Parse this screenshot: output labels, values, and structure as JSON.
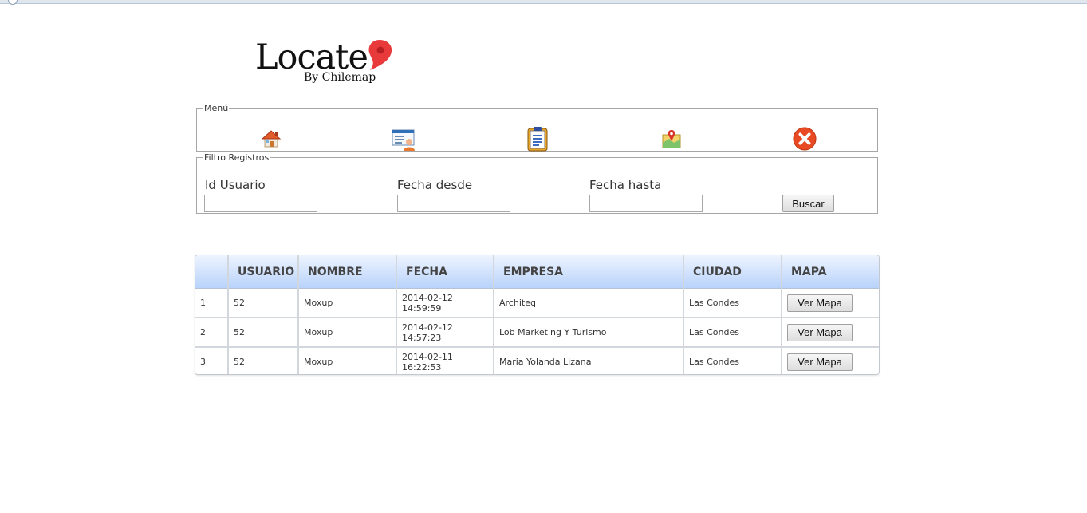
{
  "logo": {
    "brand": "Locate",
    "tagline": "By Chilemap"
  },
  "menu": {
    "legend": "Menú",
    "items": [
      {
        "icon": "home-icon"
      },
      {
        "icon": "user-list-icon"
      },
      {
        "icon": "clipboard-icon"
      },
      {
        "icon": "map-pin-icon"
      },
      {
        "icon": "close-icon"
      }
    ]
  },
  "filter": {
    "legend": "Filtro Registros",
    "user_label": "Id Usuario",
    "from_label": "Fecha desde",
    "to_label": "Fecha hasta",
    "user_value": "",
    "from_value": "",
    "to_value": "",
    "search_label": "Buscar"
  },
  "table": {
    "headers": [
      "",
      "USUARIO",
      "NOMBRE",
      "FECHA",
      "EMPRESA",
      "CIUDAD",
      "MAPA"
    ],
    "rows": [
      {
        "num": "1",
        "usuario": "52",
        "nombre": "Moxup",
        "fecha": "2014-02-12 14:59:59",
        "empresa": "Architeq",
        "ciudad": "Las Condes",
        "mapa": "Ver Mapa"
      },
      {
        "num": "2",
        "usuario": "52",
        "nombre": "Moxup",
        "fecha": "2014-02-12 14:57:23",
        "empresa": "Lob Marketing Y Turismo",
        "ciudad": "Las Condes",
        "mapa": "Ver Mapa"
      },
      {
        "num": "3",
        "usuario": "52",
        "nombre": "Moxup",
        "fecha": "2014-02-11 16:22:53",
        "empresa": "Maria Yolanda Lizana",
        "ciudad": "Las Condes",
        "mapa": "Ver Mapa"
      }
    ]
  },
  "colors": {
    "header_top": "#eef4ff",
    "header_bottom": "#b8d3fb",
    "pin": "#e8393b"
  }
}
